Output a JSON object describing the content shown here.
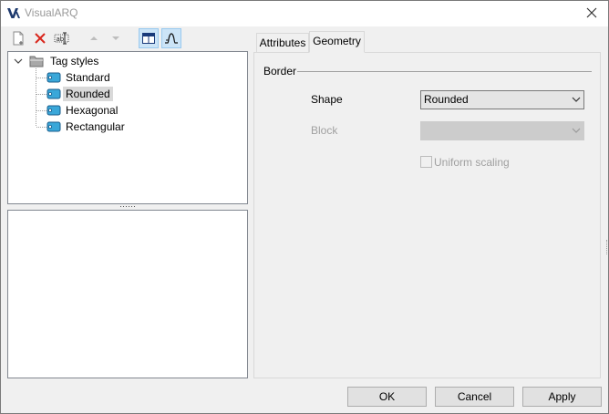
{
  "window": {
    "title": "VisualARQ"
  },
  "toolbar": {
    "icons": [
      "new-style-icon",
      "delete-icon",
      "rename-icon",
      "move-up-icon",
      "move-down-icon",
      "view-split-icon",
      "curve-icon"
    ]
  },
  "tree": {
    "root": "Tag styles",
    "items": [
      {
        "label": "Standard",
        "selected": false
      },
      {
        "label": "Rounded",
        "selected": true
      },
      {
        "label": "Hexagonal",
        "selected": false
      },
      {
        "label": "Rectangular",
        "selected": false
      }
    ]
  },
  "tabs": [
    {
      "label": "Attributes",
      "active": false
    },
    {
      "label": "Geometry",
      "active": true
    }
  ],
  "geometry": {
    "group_label": "Border",
    "shape_label": "Shape",
    "shape_value": "Rounded",
    "block_label": "Block",
    "block_value": "",
    "uniform_scaling_label": "Uniform scaling",
    "uniform_scaling_checked": false
  },
  "buttons": {
    "ok": "OK",
    "cancel": "Cancel",
    "apply": "Apply"
  },
  "colors": {
    "selection": "#d9d9d9",
    "toolbar_active": "#cce4f7",
    "delete_red": "#d9261c",
    "logo_blue": "#1e3a6e"
  }
}
